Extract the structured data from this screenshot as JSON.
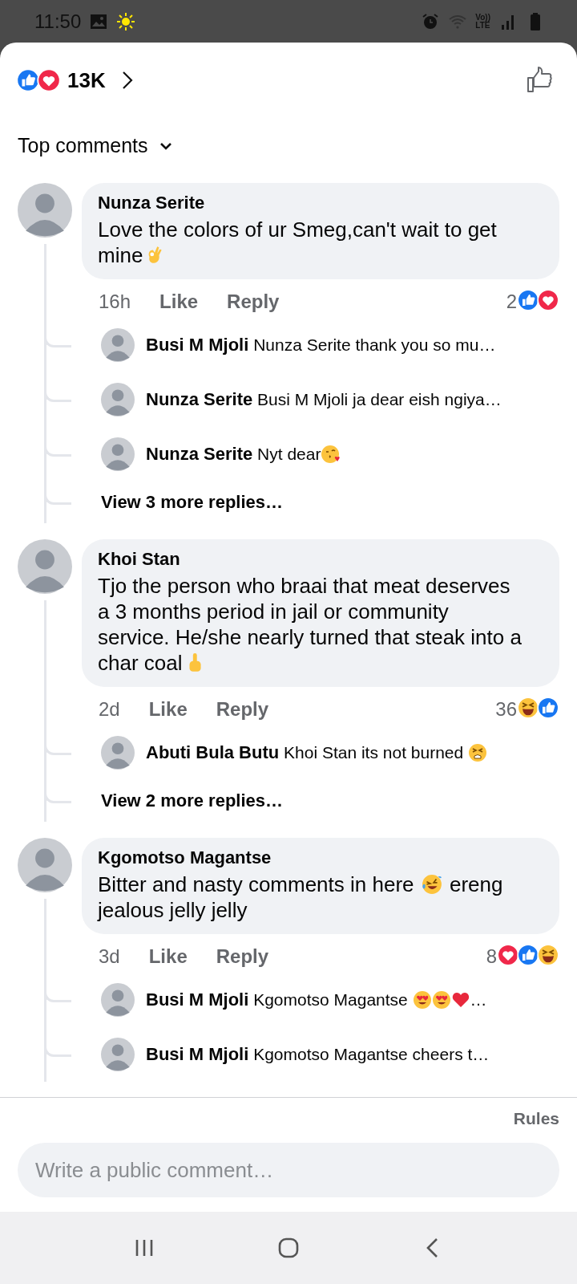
{
  "status_bar": {
    "time": "11:50",
    "indicator_lines": [
      "Vo))",
      "LTE"
    ]
  },
  "reactions_summary": {
    "reactions": [
      {
        "kind": "like"
      },
      {
        "kind": "love"
      }
    ],
    "count": "13K"
  },
  "sort": {
    "label": "Top comments"
  },
  "comments": [
    {
      "author": "Nunza Serite",
      "text": "Love the colors of ur Smeg,can't wait to get mine",
      "emoji": [
        {
          "kind": "ok-hand"
        }
      ],
      "time": "16h",
      "like": "Like",
      "reply": "Reply",
      "reaction_count": "2",
      "reactions": [
        {
          "kind": "like"
        },
        {
          "kind": "love"
        }
      ],
      "replies": [
        {
          "author": "Busi M Mjoli",
          "text": "Nunza Serite thank you so mu…"
        },
        {
          "author": "Nunza Serite",
          "text": "Busi M Mjoli ja dear eish ngiya…"
        },
        {
          "author": "Nunza Serite",
          "text": "Nyt dear",
          "emoji": [
            {
              "kind": "kiss"
            }
          ]
        }
      ],
      "more_replies": "View 3 more replies…"
    },
    {
      "author": "Khoi Stan",
      "text": "Tjo the person who braai that meat deserves a 3 months period in jail or community service. He/she nearly turned that steak into a  char coal",
      "emoji": [
        {
          "kind": "finger"
        }
      ],
      "time": "2d",
      "like": "Like",
      "reply": "Reply",
      "reaction_count": "36",
      "reactions": [
        {
          "kind": "haha"
        },
        {
          "kind": "like"
        }
      ],
      "replies": [
        {
          "author": "Abuti Bula Butu",
          "text": "Khoi Stan its not burned ",
          "emoji": [
            {
              "kind": "squint"
            }
          ]
        }
      ],
      "more_replies": "View 2 more replies…"
    },
    {
      "author": "Kgomotso Magantse",
      "text": "Bitter and nasty comments in here ",
      "emoji": [
        {
          "kind": "tears-joy"
        }
      ],
      "text_after": " ereng jealous jelly jelly",
      "time": "3d",
      "like": "Like",
      "reply": "Reply",
      "reaction_count": "8",
      "reactions": [
        {
          "kind": "love"
        },
        {
          "kind": "like"
        },
        {
          "kind": "haha"
        }
      ],
      "replies": [
        {
          "author": "Busi M Mjoli",
          "text": "Kgomotso Magantse ",
          "emoji": [
            {
              "kind": "heart-eyes"
            },
            {
              "kind": "heart-eyes"
            },
            {
              "kind": "heart"
            }
          ],
          "text_after": "…"
        },
        {
          "author": "Busi M Mjoli",
          "text": "Kgomotso Magantse cheers t…"
        }
      ]
    }
  ],
  "rules": "Rules",
  "comment_field": {
    "placeholder": "Write a public comment…"
  }
}
